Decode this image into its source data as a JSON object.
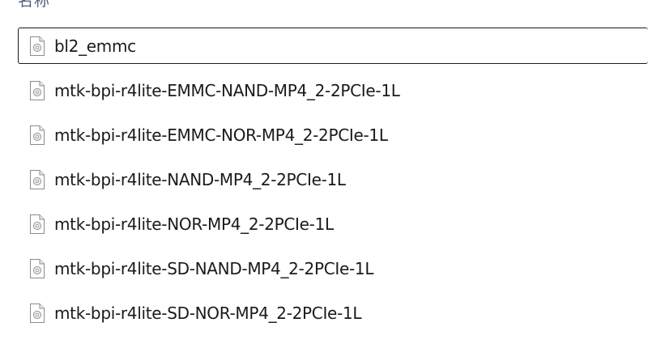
{
  "header": {
    "name_column_label": "名称"
  },
  "files": [
    {
      "name": "bl2_emmc",
      "icon": "generic-file-icon",
      "selected": true
    },
    {
      "name": "mtk-bpi-r4lite-EMMC-NAND-MP4_2-2PCIe-1L",
      "icon": "generic-file-icon",
      "selected": false
    },
    {
      "name": "mtk-bpi-r4lite-EMMC-NOR-MP4_2-2PCIe-1L",
      "icon": "generic-file-icon",
      "selected": false
    },
    {
      "name": "mtk-bpi-r4lite-NAND-MP4_2-2PCIe-1L",
      "icon": "generic-file-icon",
      "selected": false
    },
    {
      "name": "mtk-bpi-r4lite-NOR-MP4_2-2PCIe-1L",
      "icon": "generic-file-icon",
      "selected": false
    },
    {
      "name": "mtk-bpi-r4lite-SD-NAND-MP4_2-2PCIe-1L",
      "icon": "generic-file-icon",
      "selected": false
    },
    {
      "name": "mtk-bpi-r4lite-SD-NOR-MP4_2-2PCIe-1L",
      "icon": "generic-file-icon",
      "selected": false
    }
  ]
}
